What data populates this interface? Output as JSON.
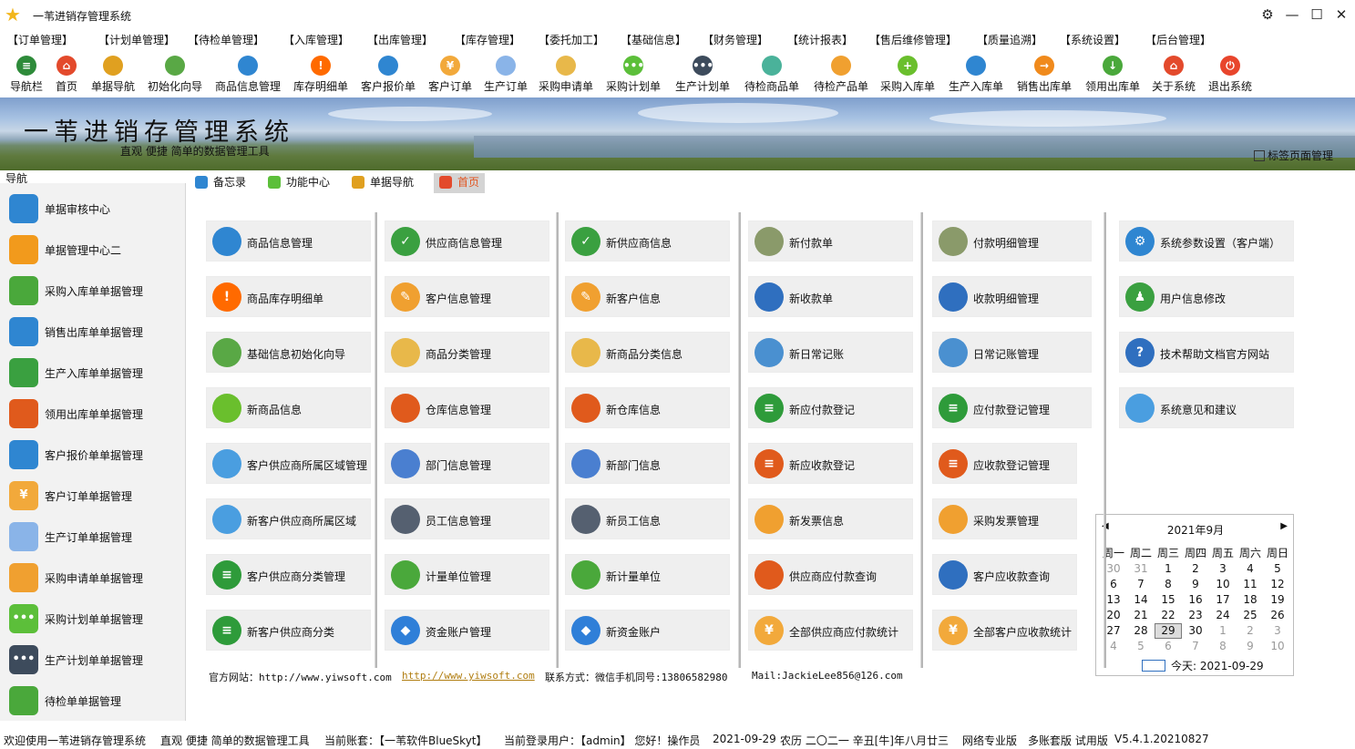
{
  "window": {
    "title": "一苇进销存管理系统"
  },
  "menu": [
    "【订单管理】",
    "【计划单管理】",
    "【待检单管理】",
    "【入库管理】",
    "【出库管理】",
    "【库存管理】",
    "【委托加工】",
    "【基础信息】",
    "【财务管理】",
    "【统计报表】",
    "【售后维修管理】",
    "【质量追溯】",
    "【系统设置】",
    "【后台管理】"
  ],
  "toolbar": [
    {
      "label": "导航栏",
      "icon": "menu-icon",
      "color": "#2e8b3a"
    },
    {
      "label": "首页",
      "icon": "home-icon",
      "color": "#e34a2c"
    },
    {
      "label": "单据导航",
      "icon": "navigation-icon",
      "color": "#e0a020"
    },
    {
      "label": "初始化向导",
      "icon": "wand-icon",
      "color": "#59a845"
    },
    {
      "label": "商品信息管理",
      "icon": "cubes-icon",
      "color": "#2f86d1"
    },
    {
      "label": "库存明细单",
      "icon": "alert-icon",
      "color": "#ff6a00"
    },
    {
      "label": "客户报价单",
      "icon": "tag-icon",
      "color": "#2f86d1"
    },
    {
      "label": "客户订单",
      "icon": "coin-icon",
      "color": "#f2a93b"
    },
    {
      "label": "生产订单",
      "icon": "document-icon",
      "color": "#8ab4e8"
    },
    {
      "label": "采购申请单",
      "icon": "form-icon",
      "color": "#e8b84a"
    },
    {
      "label": "采购计划单",
      "icon": "chat-icon",
      "color": "#5cbf3a"
    },
    {
      "label": "生产计划单",
      "icon": "chat-dark-icon",
      "color": "#3d4b5c"
    },
    {
      "label": "待检商品单",
      "icon": "flask-icon",
      "color": "#4ab29a"
    },
    {
      "label": "待检产品单",
      "icon": "beaker-icon",
      "color": "#f0a030"
    },
    {
      "label": "采购入库单",
      "icon": "plus-icon",
      "color": "#6abf2d"
    },
    {
      "label": "生产入库单",
      "icon": "forklift-icon",
      "color": "#2f86d1"
    },
    {
      "label": "销售出库单",
      "icon": "exit-icon",
      "color": "#f08a1c"
    },
    {
      "label": "领用出库单",
      "icon": "download-icon",
      "color": "#4aa83b"
    },
    {
      "label": "关于系统",
      "icon": "info-home-icon",
      "color": "#e34a2c"
    },
    {
      "label": "退出系统",
      "icon": "power-icon",
      "color": "#e8452c"
    }
  ],
  "banner": {
    "title": "一苇进销存管理系统",
    "subtitle": "直观 便捷 简单的数据管理工具",
    "tab_manage": "标签页面管理"
  },
  "nav": {
    "header": "导航",
    "items": [
      {
        "label": "单据审核中心",
        "icon": "grid-icon",
        "color": "#2f86d1"
      },
      {
        "label": "单据管理中心二",
        "icon": "grid-orange-icon",
        "color": "#f29a1c"
      },
      {
        "label": "采购入库单单据管理",
        "icon": "truck-icon",
        "color": "#4aa83b"
      },
      {
        "label": "销售出库单单据管理",
        "icon": "warehouse-icon",
        "color": "#2f86d1"
      },
      {
        "label": "生产入库单单据管理",
        "icon": "arrow-in-icon",
        "color": "#3aa040"
      },
      {
        "label": "领用出库单单据管理",
        "icon": "arrow-out-icon",
        "color": "#e05a1c"
      },
      {
        "label": "客户报价单单据管理",
        "icon": "books-icon",
        "color": "#2f86d1"
      },
      {
        "label": "客户订单单据管理",
        "icon": "coin-icon",
        "color": "#f2a93b"
      },
      {
        "label": "生产订单单据管理",
        "icon": "document-icon",
        "color": "#8ab4e8"
      },
      {
        "label": "采购申请单单据管理",
        "icon": "mail-icon",
        "color": "#f0a030"
      },
      {
        "label": "采购计划单单据管理",
        "icon": "chat-icon",
        "color": "#5cbf3a"
      },
      {
        "label": "生产计划单单据管理",
        "icon": "chat-dark-icon",
        "color": "#3d4b5c"
      },
      {
        "label": "待检单单据管理",
        "icon": "clipboard-icon",
        "color": "#4aa83b"
      }
    ]
  },
  "tabs": [
    {
      "label": "备忘录",
      "icon": "memo-icon",
      "color": "#2f86d1",
      "active": false
    },
    {
      "label": "功能中心",
      "icon": "function-icon",
      "color": "#5cbf3a",
      "active": false
    },
    {
      "label": "单据导航",
      "icon": "navigation-icon",
      "color": "#e0a020",
      "active": false
    },
    {
      "label": "首页",
      "icon": "home-icon",
      "color": "#e34a2c",
      "active": true
    }
  ],
  "columns": [
    [
      {
        "label": "商品信息管理",
        "icon": "cubes-icon",
        "color": "#2f86d1"
      },
      {
        "label": "商品库存明细单",
        "icon": "alert-icon",
        "color": "#ff6a00"
      },
      {
        "label": "基础信息初始化向导",
        "icon": "wand-icon",
        "color": "#59a845"
      },
      {
        "label": "新商品信息",
        "icon": "box-icon",
        "color": "#6abf2d"
      },
      {
        "label": "客户供应商所属区域管理",
        "icon": "map-icon",
        "color": "#4a9ee0"
      },
      {
        "label": "新客户供应商所属区域",
        "icon": "map-icon",
        "color": "#4a9ee0"
      },
      {
        "label": "客户供应商分类管理",
        "icon": "list-tree-icon",
        "color": "#2e9b3a"
      },
      {
        "label": "新客户供应商分类",
        "icon": "list-tree-icon",
        "color": "#2e9b3a"
      }
    ],
    [
      {
        "label": "供应商信息管理",
        "icon": "check-book-icon",
        "color": "#3aa040"
      },
      {
        "label": "客户信息管理",
        "icon": "edit-book-icon",
        "color": "#f0a030"
      },
      {
        "label": "商品分类管理",
        "icon": "price-tag-icon",
        "color": "#e8b84a"
      },
      {
        "label": "仓库信息管理",
        "icon": "warehouse-icon",
        "color": "#e05a1c"
      },
      {
        "label": "部门信息管理",
        "icon": "add-user-icon",
        "color": "#4a7fd0"
      },
      {
        "label": "员工信息管理",
        "icon": "id-card-icon",
        "color": "#556070"
      },
      {
        "label": "计量单位管理",
        "icon": "ruler-icon",
        "color": "#4aa83b"
      },
      {
        "label": "资金账户管理",
        "icon": "diamond-icon",
        "color": "#2f7fd8"
      }
    ],
    [
      {
        "label": "新供应商信息",
        "icon": "check-book-icon",
        "color": "#3aa040"
      },
      {
        "label": "新客户信息",
        "icon": "edit-book-icon",
        "color": "#f0a030"
      },
      {
        "label": "新商品分类信息",
        "icon": "price-tag-icon",
        "color": "#e8b84a"
      },
      {
        "label": "新仓库信息",
        "icon": "warehouse-icon",
        "color": "#e05a1c"
      },
      {
        "label": "新部门信息",
        "icon": "add-user-icon",
        "color": "#4a7fd0"
      },
      {
        "label": "新员工信息",
        "icon": "id-card-icon",
        "color": "#556070"
      },
      {
        "label": "新计量单位",
        "icon": "ruler-icon",
        "color": "#4aa83b"
      },
      {
        "label": "新资金账户",
        "icon": "diamond-icon",
        "color": "#2f7fd8"
      }
    ],
    [
      {
        "label": "新付款单",
        "icon": "money-chart-icon",
        "color": "#8a9a6a"
      },
      {
        "label": "新收款单",
        "icon": "clock-coins-icon",
        "color": "#2f6fbf"
      },
      {
        "label": "新日常记账",
        "icon": "ledger-icon",
        "color": "#4a90d0"
      },
      {
        "label": "新应付款登记",
        "icon": "list-arrow-icon",
        "color": "#2e9b3a"
      },
      {
        "label": "新应收款登记",
        "icon": "list-arrow-in-icon",
        "color": "#e05a1c"
      },
      {
        "label": "新发票信息",
        "icon": "invoice-mail-icon",
        "color": "#f0a030"
      },
      {
        "label": "供应商应付款查询",
        "icon": "search-doc-icon",
        "color": "#e05a1c"
      },
      {
        "label": "全部供应商应付款统计",
        "icon": "coin-stat-icon",
        "color": "#f2a93b"
      }
    ],
    [
      {
        "label": "付款明细管理",
        "icon": "money-chart-icon",
        "color": "#8a9a6a"
      },
      {
        "label": "收款明细管理",
        "icon": "clock-coins-icon",
        "color": "#2f6fbf"
      },
      {
        "label": "日常记账管理",
        "icon": "ledger-icon",
        "color": "#4a90d0"
      },
      {
        "label": "应付款登记管理",
        "icon": "list-arrow-icon",
        "color": "#2e9b3a"
      },
      {
        "label": "应收款登记管理",
        "icon": "list-arrow-in-icon",
        "color": "#e05a1c"
      },
      {
        "label": "采购发票管理",
        "icon": "invoice-mail-icon",
        "color": "#f0a030"
      },
      {
        "label": "客户应收款查询",
        "icon": "search-doc-icon",
        "color": "#2f6fbf"
      },
      {
        "label": "全部客户应收款统计",
        "icon": "coin-stat-icon",
        "color": "#f2a93b"
      }
    ],
    [
      {
        "label": "系统参数设置（客户端）",
        "icon": "gear-icon",
        "color": "#2f86d1"
      },
      {
        "label": "用户信息修改",
        "icon": "user-icon",
        "color": "#3aa040"
      },
      {
        "label": "技术帮助文档官方网站",
        "icon": "help-icon",
        "color": "#2f6fbf"
      },
      {
        "label": "系统意见和建议",
        "icon": "feedback-icon",
        "color": "#4a9ee0"
      }
    ]
  ],
  "footer": {
    "site_label": "官方网站：http://www.yiwsoft.com",
    "site_link": "http://www.yiwsoft.com",
    "contact": "联系方式：微信手机同号:13806582980",
    "mail": "Mail:JackieLee856@126.com"
  },
  "calendar": {
    "month_label": "2021年9月",
    "weekdays": [
      "周一",
      "周二",
      "周三",
      "周四",
      "周五",
      "周六",
      "周日"
    ],
    "weeks": [
      [
        "30",
        "31",
        "1",
        "2",
        "3",
        "4",
        "5"
      ],
      [
        "6",
        "7",
        "8",
        "9",
        "10",
        "11",
        "12"
      ],
      [
        "13",
        "14",
        "15",
        "16",
        "17",
        "18",
        "19"
      ],
      [
        "20",
        "21",
        "22",
        "23",
        "24",
        "25",
        "26"
      ],
      [
        "27",
        "28",
        "29",
        "30",
        "1",
        "2",
        "3"
      ],
      [
        "4",
        "5",
        "6",
        "7",
        "8",
        "9",
        "10"
      ]
    ],
    "selected_day": "29",
    "today_label": "今天: 2021-09-29"
  },
  "status": [
    "欢迎使用一苇进销存管理系统",
    "直观 便捷 简单的数据管理工具",
    "当前账套：【一苇软件BlueSkyt】",
    "当前登录用户：【admin】 您好！操作员",
    "2021-09-29",
    "农历 二〇二一 辛丑[牛]年八月廿三",
    "网络专业版",
    "多账套版 试用版",
    "V5.4.1.20210827"
  ]
}
